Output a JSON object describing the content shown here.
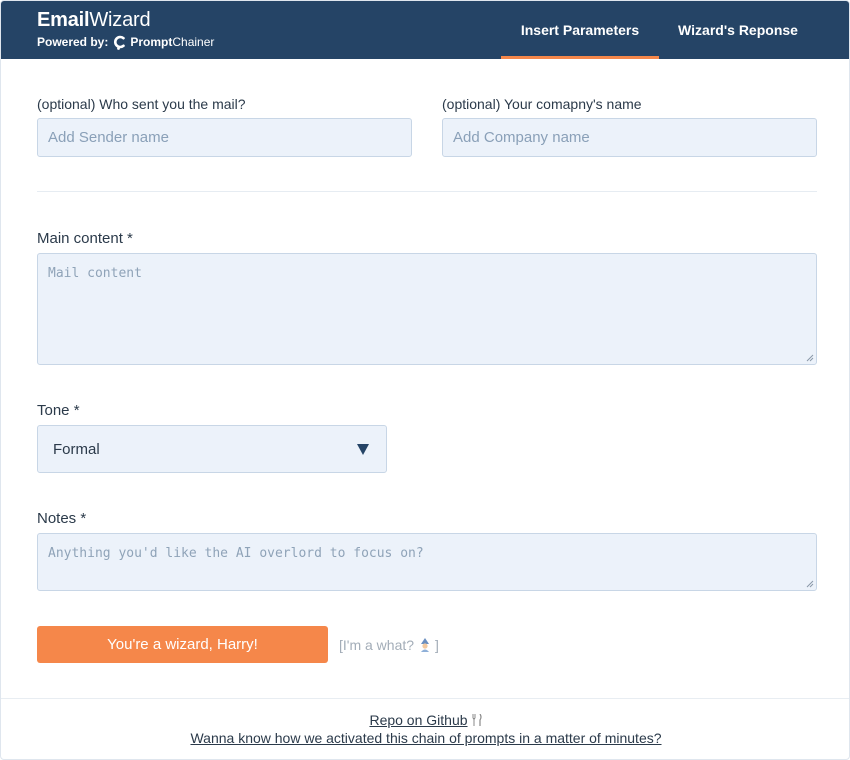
{
  "header": {
    "brand_bold": "Email",
    "brand_regular": "Wizard",
    "powered_label": "Powered by:",
    "powered_brand_bold": "Prompt",
    "powered_brand_regular": "Chainer",
    "tabs": [
      {
        "label": "Insert Parameters",
        "active": true
      },
      {
        "label": "Wizard's Reponse",
        "active": false
      }
    ]
  },
  "form": {
    "sender": {
      "label": "(optional) Who sent you the mail?",
      "placeholder": "Add Sender name",
      "value": ""
    },
    "company": {
      "label": "(optional) Your comapny's name",
      "placeholder": "Add Company name",
      "value": ""
    },
    "content": {
      "label": "Main content *",
      "placeholder": "Mail content",
      "value": ""
    },
    "tone": {
      "label": "Tone *",
      "selected": "Formal"
    },
    "notes": {
      "label": "Notes *",
      "placeholder": "Anything you'd like the AI overlord to focus on?",
      "value": ""
    },
    "submit_label": "You're a wizard, Harry!",
    "hint_prefix": "[I'm a what?",
    "hint_suffix": "]"
  },
  "footer": {
    "repo_link": "Repo on Github",
    "chain_link": "Wanna know how we activated this chain of prompts in a matter of minutes?"
  },
  "colors": {
    "header_bg": "#254466",
    "accent": "#f5874a",
    "field_bg": "#ecf2fa",
    "field_border": "#c8d6e6"
  },
  "icons": [
    "promptchainer-logo-icon",
    "dropdown-arrow-icon",
    "wizard-icon",
    "fork-icon",
    "resize-handle-icon"
  ]
}
